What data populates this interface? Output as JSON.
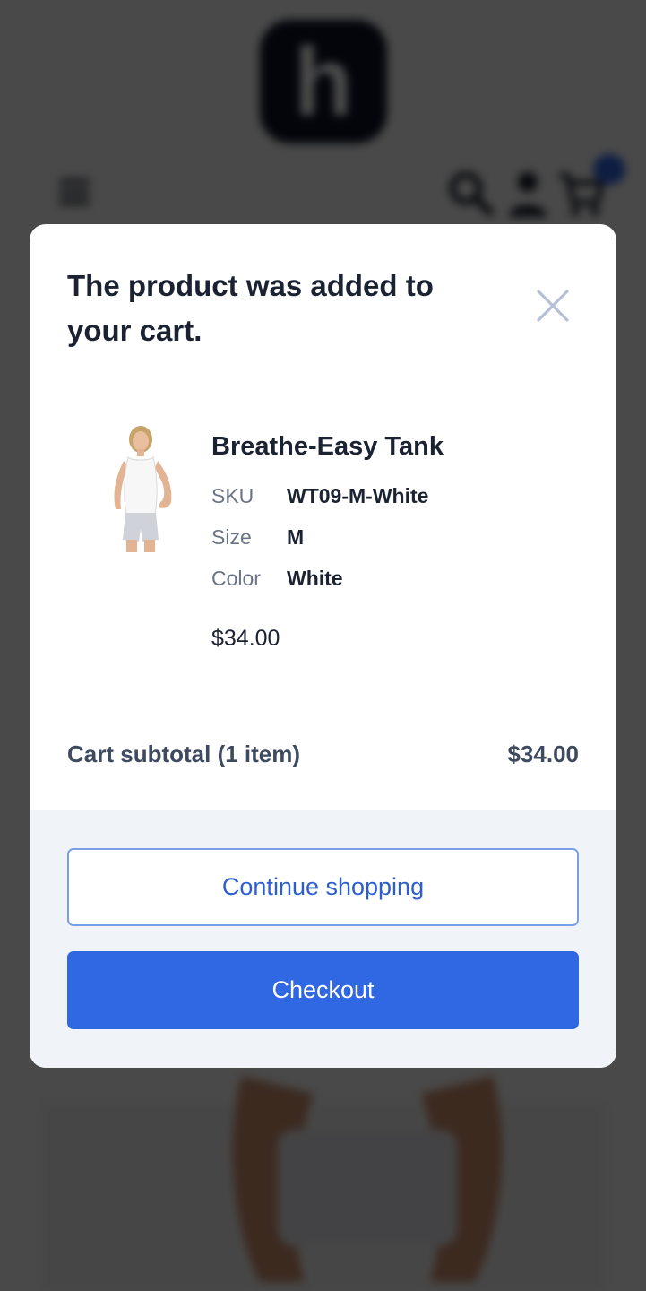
{
  "background": {
    "logo_glyph": "h",
    "icons": [
      "menu-icon",
      "search-icon",
      "user-icon",
      "cart-icon"
    ]
  },
  "modal": {
    "title": "The product was added to your cart.",
    "close_icon": "close-icon",
    "product": {
      "name": "Breathe-Easy Tank",
      "attributes": [
        {
          "label": "SKU",
          "value": "WT09-M-White"
        },
        {
          "label": "Size",
          "value": "M"
        },
        {
          "label": "Color",
          "value": "White"
        }
      ],
      "price": "$34.00"
    },
    "subtotal": {
      "label": "Cart subtotal (1 item)",
      "value": "$34.00"
    },
    "buttons": {
      "continue": "Continue shopping",
      "checkout": "Checkout"
    }
  },
  "colors": {
    "primary": "#3068e3",
    "text_dark": "#1b2232",
    "text_muted": "#6b7485",
    "footer_bg": "#f0f4f8",
    "badge": "#2f62dd"
  }
}
